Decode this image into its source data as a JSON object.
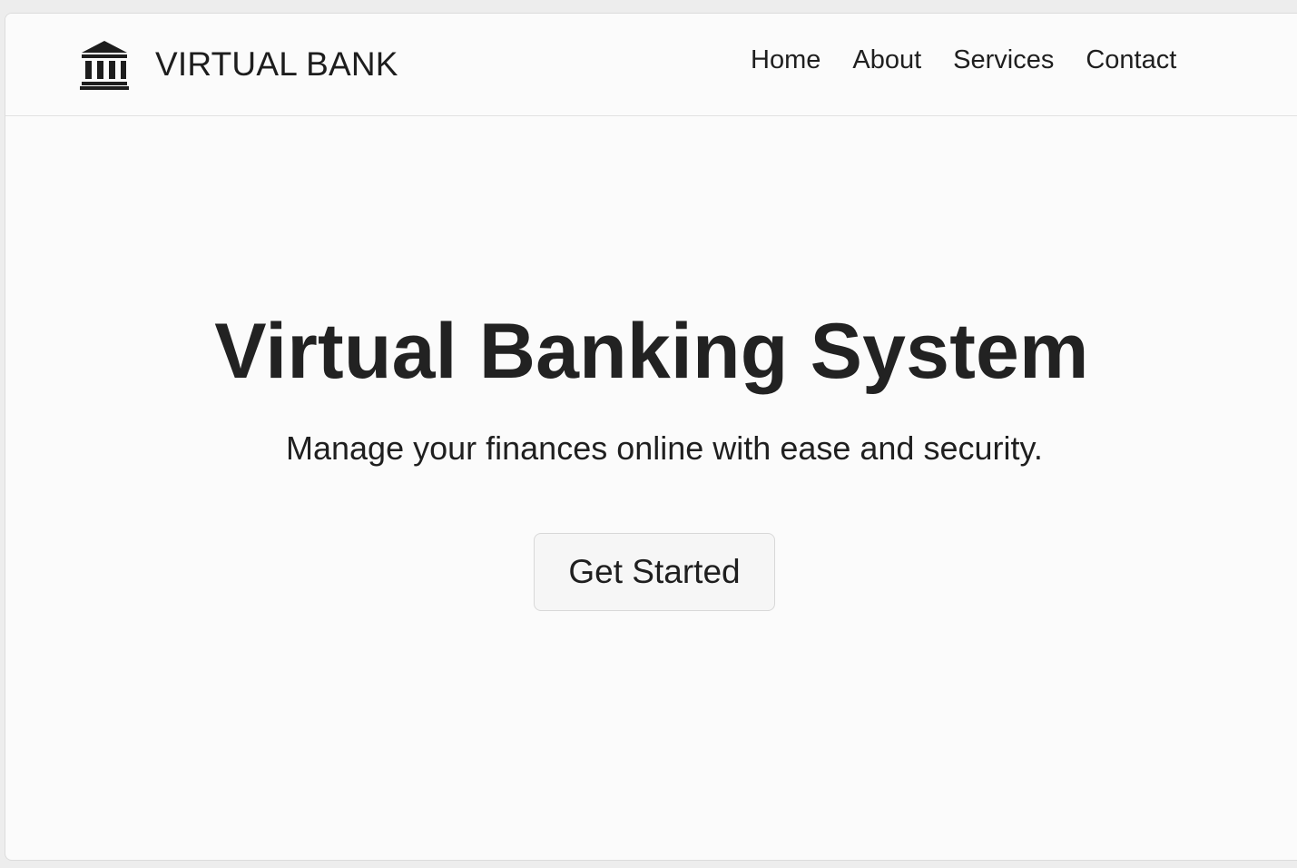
{
  "header": {
    "brand_icon": "bank-building-icon",
    "brand_name": "VIRTUAL BANK",
    "nav": [
      {
        "label": "Home"
      },
      {
        "label": "About"
      },
      {
        "label": "Services"
      },
      {
        "label": "Contact"
      }
    ]
  },
  "hero": {
    "title": "Virtual Banking System",
    "subtitle": "Manage your finances online with ease and security.",
    "cta_label": "Get Started"
  },
  "colors": {
    "background": "#fbfbfb",
    "text": "#1f1f1f",
    "button_background": "#f6f6f6",
    "border": "#dcdcdc"
  }
}
